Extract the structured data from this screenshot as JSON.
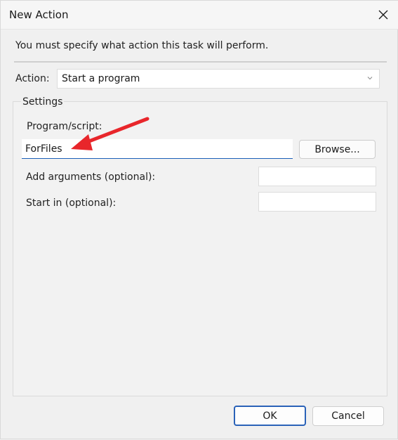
{
  "window": {
    "title": "New Action"
  },
  "prompt": "You must specify what action this task will perform.",
  "action": {
    "label": "Action:",
    "selected": "Start a program"
  },
  "settings": {
    "legend": "Settings",
    "program_label": "Program/script:",
    "program_value": "ForFiles",
    "browse_label": "Browse...",
    "args_label": "Add arguments (optional):",
    "args_value": "",
    "start_in_label": "Start in (optional):",
    "start_in_value": ""
  },
  "footer": {
    "ok_label": "OK",
    "cancel_label": "Cancel"
  },
  "colors": {
    "accent": "#2a62b8",
    "annotation_arrow": "#e8262b"
  },
  "icons": {
    "close": "close-icon",
    "dropdown": "chevron-down-icon"
  }
}
